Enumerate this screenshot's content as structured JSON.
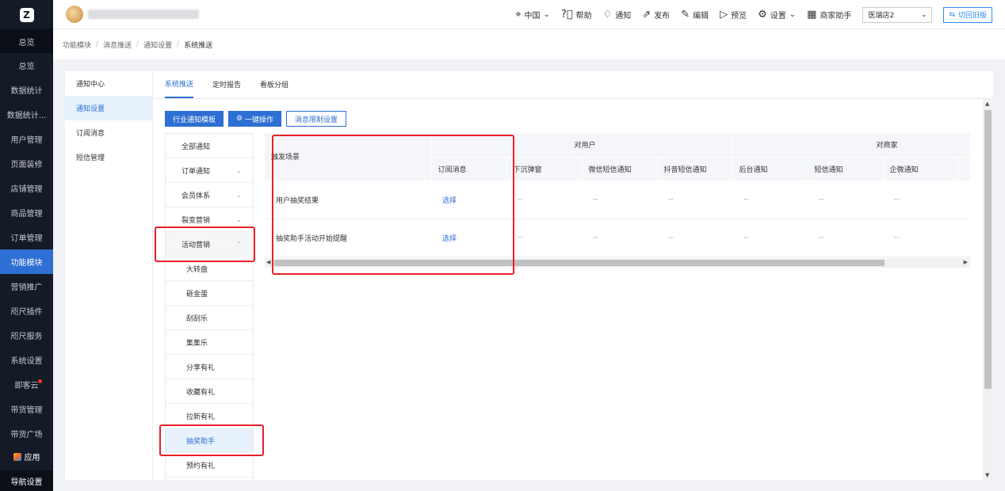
{
  "sidenav": {
    "head": "总览",
    "items": [
      "总览",
      "数据统计",
      "数据统计...",
      "用户管理",
      "页面装修",
      "店铺管理",
      "商品管理",
      "订单管理",
      "功能模块",
      "营销推广",
      "咫尺插件",
      "咫尺服务",
      "系统设置",
      "即客云",
      "带货管理",
      "带货广场"
    ],
    "active_index": 8,
    "app_label": "应用",
    "bottom": "导航设置"
  },
  "topbar": {
    "region": "中国",
    "help": "帮助",
    "notify": "通知",
    "publish": "发布",
    "edit": "编辑",
    "preview": "预览",
    "settings": "设置",
    "merchant_assistant": "商家助手",
    "store_select": "医瑞店2",
    "switch_old": "切回旧版"
  },
  "breadcrumb": [
    "功能模块",
    "消息推送",
    "通知设置",
    "系统推送"
  ],
  "leftnav": [
    "通知中心",
    "通知设置",
    "订阅消息",
    "短信管理"
  ],
  "leftnav_active": 1,
  "tabs": [
    "系统推送",
    "定时报告",
    "看板分组"
  ],
  "tab_active": 0,
  "buttons": {
    "industry": "行业通知模板",
    "oneclick": "一键操作",
    "limit": "消息限制设置"
  },
  "categories": [
    {
      "label": "全部通知",
      "chev": ""
    },
    {
      "label": "订单通知",
      "chev": "⌄"
    },
    {
      "label": "会员体系",
      "chev": "⌄"
    },
    {
      "label": "裂变营销",
      "chev": "⌄"
    },
    {
      "label": "活动营销",
      "chev": "⌃"
    },
    {
      "label": "大转盘",
      "chev": ""
    },
    {
      "label": "砸金蛋",
      "chev": ""
    },
    {
      "label": "刮刮乐",
      "chev": ""
    },
    {
      "label": "集集乐",
      "chev": ""
    },
    {
      "label": "分享有礼",
      "chev": ""
    },
    {
      "label": "收藏有礼",
      "chev": ""
    },
    {
      "label": "拉新有礼",
      "chev": ""
    },
    {
      "label": "抽奖助手",
      "chev": ""
    },
    {
      "label": "预约有礼",
      "chev": ""
    }
  ],
  "table": {
    "scene_header": "触发场景",
    "group_user": "对用户",
    "group_merchant": "对商家",
    "sub_headers": [
      "订阅消息",
      "下沉弹窗",
      "微信短信通知",
      "抖音短信通知",
      "后台通知",
      "短信通知",
      "企微通知"
    ],
    "rows": [
      {
        "scene": "用户抽奖结果",
        "subscribe": "选择",
        "cells": [
          "--",
          "--",
          "--",
          "--",
          "--",
          "--"
        ]
      },
      {
        "scene": "抽奖助手活动开始提醒",
        "subscribe": "选择",
        "cells": [
          "--",
          "--",
          "--",
          "--",
          "--",
          "--"
        ]
      }
    ]
  },
  "colors": {
    "accent": "#2d6fd2",
    "highlight": "#e8202a",
    "nav_bg": "#141a26"
  }
}
